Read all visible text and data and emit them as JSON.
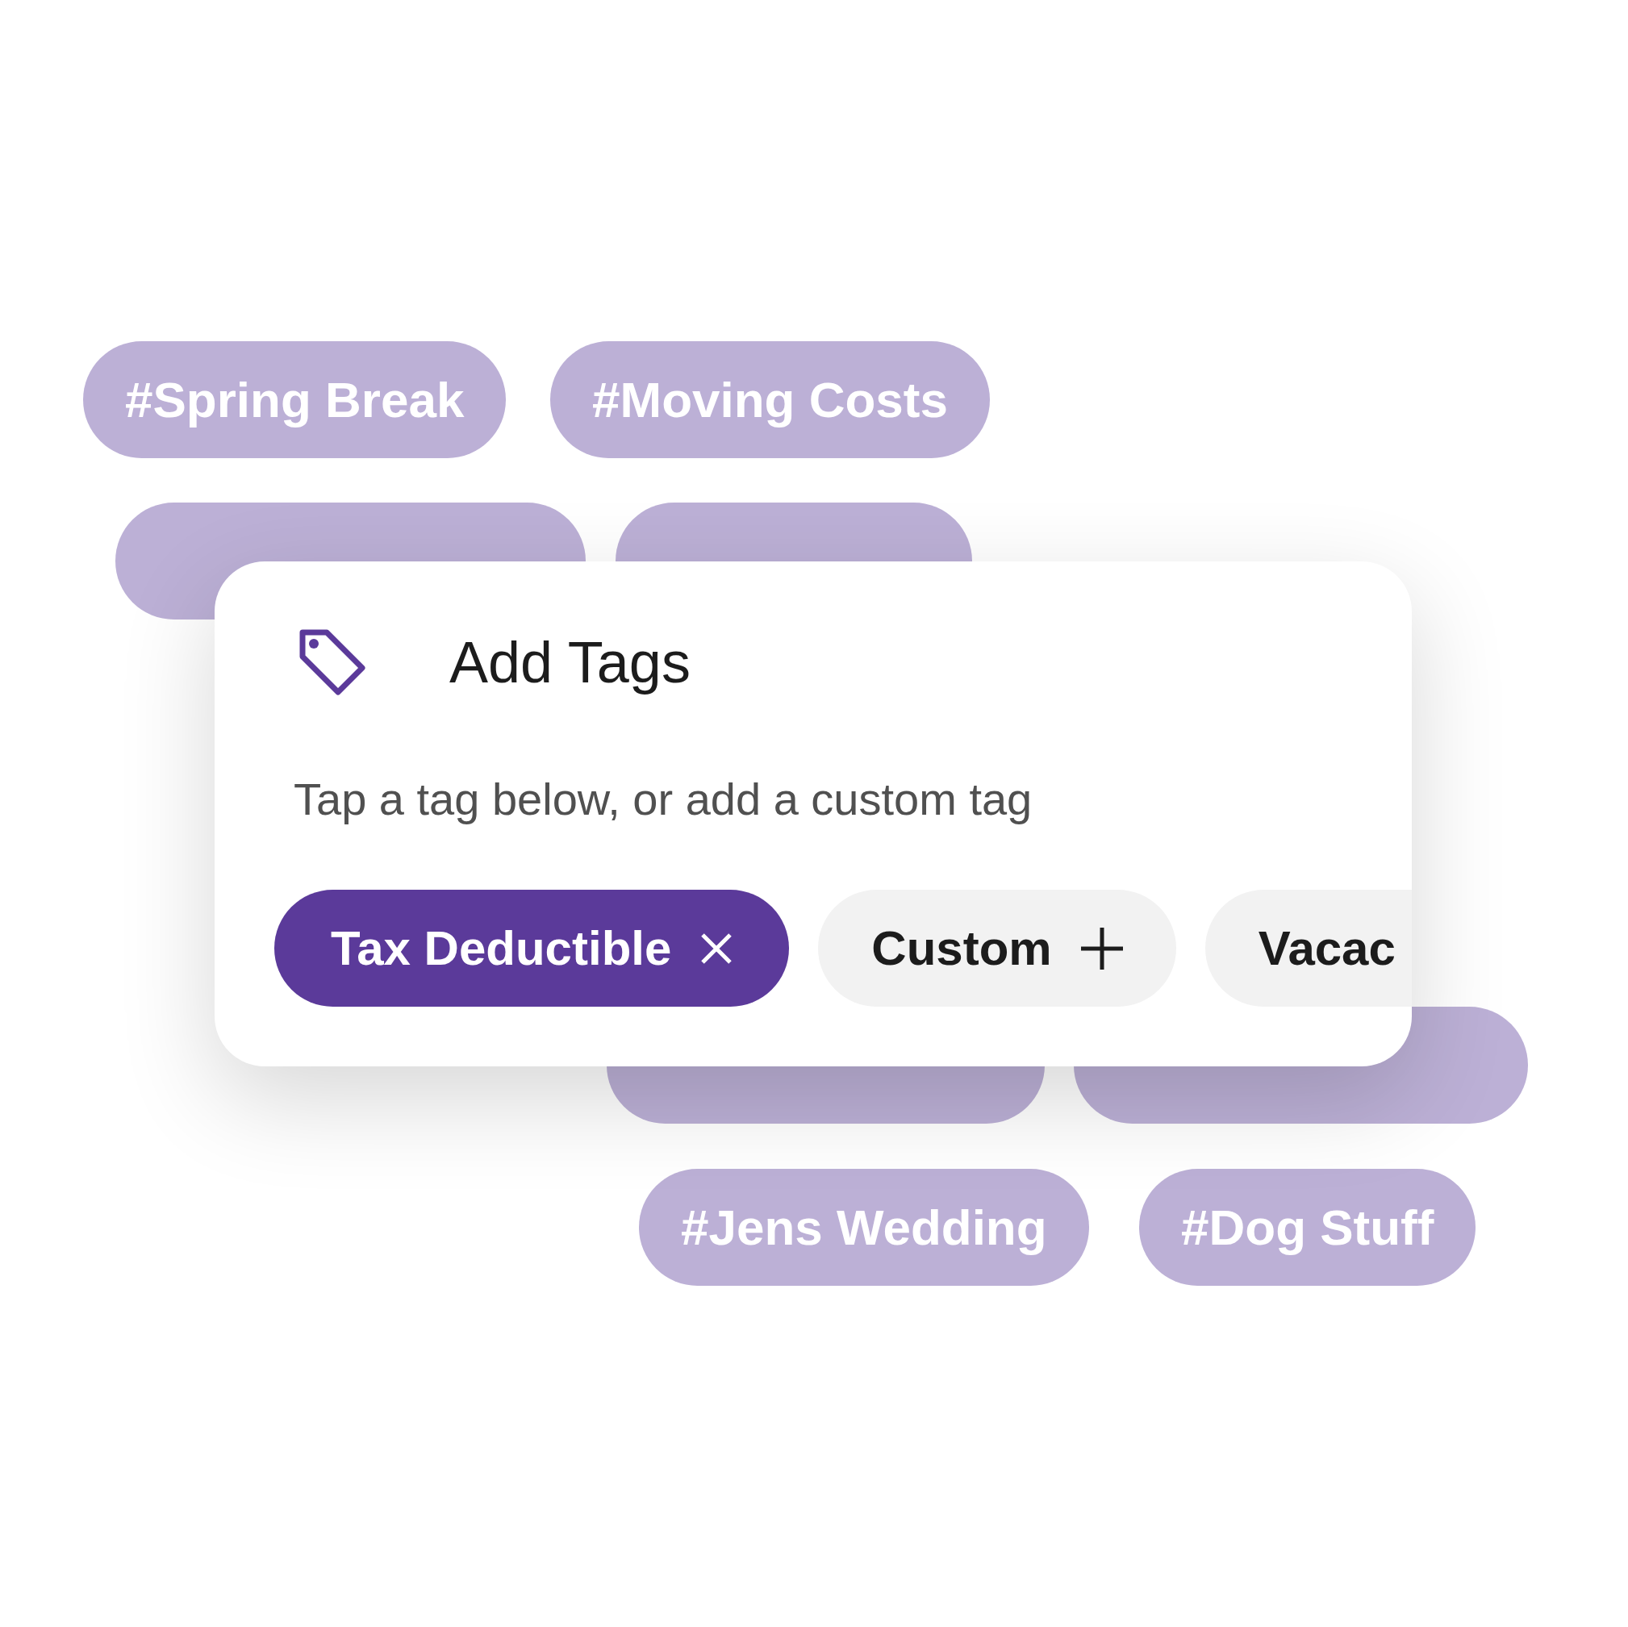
{
  "background_tags": [
    {
      "label": "#Spring Break"
    },
    {
      "label": "#Moving Costs"
    },
    {
      "covered": true
    },
    {
      "covered": true
    },
    {
      "covered": true
    },
    {
      "covered": true
    },
    {
      "label": "#Jens Wedding"
    },
    {
      "label": "#Dog Stuff"
    }
  ],
  "dialog": {
    "title": "Add Tags",
    "subtitle": "Tap a tag below, or add a custom tag",
    "chips": [
      {
        "label": "Tax Deductible",
        "selected": true,
        "kind": "remove"
      },
      {
        "label": "Custom",
        "selected": false,
        "kind": "add"
      },
      {
        "label": "Vacac",
        "selected": false,
        "kind": "plain"
      }
    ]
  }
}
